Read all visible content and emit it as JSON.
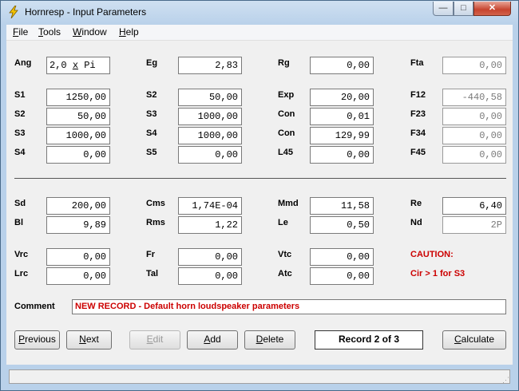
{
  "window": {
    "title": "Hornresp - Input Parameters",
    "controls": {
      "minimize": "—",
      "maximize": "□",
      "close": "✕"
    },
    "accent": "#cfe0f1"
  },
  "menu": [
    {
      "first": "F",
      "rest": "ile"
    },
    {
      "first": "T",
      "rest": "ools"
    },
    {
      "first": "W",
      "rest": "indow"
    },
    {
      "first": "H",
      "rest": "elp"
    }
  ],
  "params": {
    "ang": {
      "label": "Ang",
      "value_num": "2,0",
      "value_x": "x",
      "value_pi": " Pi"
    },
    "eg": {
      "label": "Eg",
      "value": "2,83"
    },
    "rg": {
      "label": "Rg",
      "value": "0,00"
    },
    "fta": {
      "label": "Fta",
      "value": "0,00"
    },
    "s1": {
      "label": "S1",
      "value": "1250,00"
    },
    "s2a": {
      "label": "S2",
      "value": "50,00"
    },
    "exp": {
      "label": "Exp",
      "value": "20,00"
    },
    "f12": {
      "label": "F12",
      "value": "-440,58"
    },
    "s2b": {
      "label": "S2",
      "value": "50,00"
    },
    "s3a": {
      "label": "S3",
      "value": "1000,00"
    },
    "con1": {
      "label": "Con",
      "value": "0,01"
    },
    "f23": {
      "label": "F23",
      "value": "0,00"
    },
    "s3b": {
      "label": "S3",
      "value": "1000,00"
    },
    "s4a": {
      "label": "S4",
      "value": "1000,00"
    },
    "con2": {
      "label": "Con",
      "value": "129,99"
    },
    "f34": {
      "label": "F34",
      "value": "0,00"
    },
    "s4b": {
      "label": "S4",
      "value": "0,00"
    },
    "s5": {
      "label": "S5",
      "value": "0,00"
    },
    "l45": {
      "label": "L45",
      "value": "0,00"
    },
    "f45": {
      "label": "F45",
      "value": "0,00"
    },
    "sd": {
      "label": "Sd",
      "value": "200,00"
    },
    "cms": {
      "label": "Cms",
      "value": "1,74E-04"
    },
    "mmd": {
      "label": "Mmd",
      "value": "11,58"
    },
    "re": {
      "label": "Re",
      "value": "6,40"
    },
    "bl": {
      "label": "Bl",
      "value": "9,89"
    },
    "rms": {
      "label": "Rms",
      "value": "1,22"
    },
    "le": {
      "label": "Le",
      "value": "0,50"
    },
    "nd": {
      "label": "Nd",
      "value": "2P"
    },
    "vrc": {
      "label": "Vrc",
      "value": "0,00"
    },
    "fr": {
      "label": "Fr",
      "value": "0,00"
    },
    "vtc": {
      "label": "Vtc",
      "value": "0,00"
    },
    "lrc": {
      "label": "Lrc",
      "value": "0,00"
    },
    "tal": {
      "label": "Tal",
      "value": "0,00"
    },
    "atc": {
      "label": "Atc",
      "value": "0,00"
    }
  },
  "caution": {
    "title": "CAUTION:",
    "message": "Cir > 1 for S3",
    "color": "#cc0000"
  },
  "comment": {
    "label": "Comment",
    "value": "NEW RECORD - Default horn loudspeaker parameters"
  },
  "buttons": {
    "previous": {
      "first": "P",
      "rest": "revious"
    },
    "next": {
      "first": "N",
      "rest": "ext"
    },
    "edit": {
      "first": "E",
      "rest": "dit"
    },
    "add": {
      "first": "A",
      "rest": "dd"
    },
    "delete": {
      "first": "D",
      "rest": "elete"
    },
    "calculate": {
      "first": "C",
      "rest": "alculate"
    }
  },
  "record": "Record 2 of 3"
}
